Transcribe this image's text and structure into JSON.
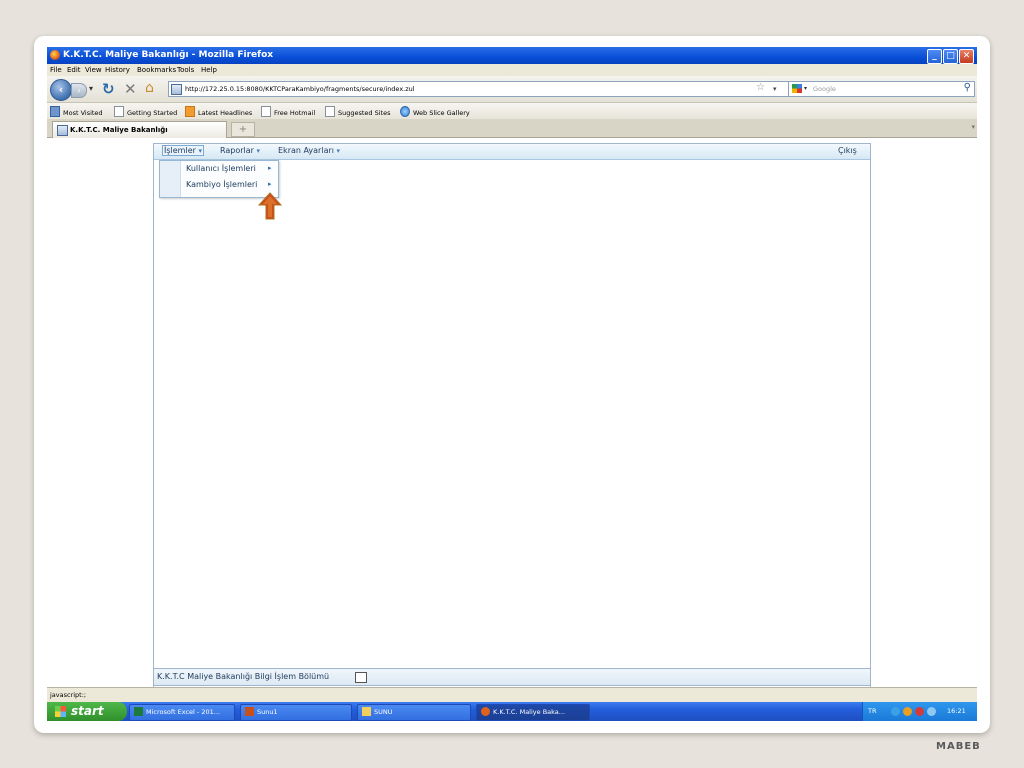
{
  "window": {
    "title": "K.K.T.C. Maliye Bakanlığı - Mozilla Firefox",
    "buttons": [
      "minimize",
      "maximize",
      "close"
    ]
  },
  "menubar": {
    "items": [
      "File",
      "Edit",
      "View",
      "History",
      "Bookmarks",
      "Tools",
      "Help"
    ]
  },
  "navbar": {
    "url": "http://172.25.0.15:8080/KKTCParaKambiyo/fragments/secure/index.zul",
    "search_placeholder": "Google"
  },
  "bookmarks": {
    "items": [
      "Most Visited",
      "Getting Started",
      "Latest Headlines",
      "Free Hotmail",
      "Suggested Sites",
      "Web Slice Gallery"
    ]
  },
  "tabs": {
    "active": "K.K.T.C. Maliye Bakanlığı",
    "new_tab": "+"
  },
  "app": {
    "menu": {
      "islemler": "İşlemler",
      "raporlar": "Raporlar",
      "ekran": "Ekran Ayarları",
      "cikis": "Çıkış",
      "caret": "▾"
    },
    "dropdown": {
      "items": [
        "Kullanıcı İşlemleri",
        "Kambiyo İşlemleri"
      ],
      "submenu_glyph": "▸"
    },
    "footer": "K.K.T.C Maliye Bakanlığı Bilgi İşlem Bölümü"
  },
  "statusbar": {
    "text": "javascript:;"
  },
  "taskbar": {
    "start": "start",
    "tasks": [
      "Microsoft Excel - 201...",
      "Sunu1",
      "SUNU",
      "K.K.T.C. Maliye Baka..."
    ],
    "language": "TR",
    "clock": "16:21"
  },
  "slide_footer": "MABEB",
  "colors": {
    "titlebar": "#0a4fd8",
    "app_border": "#9fb6cd",
    "arrow": "#d04a1c"
  }
}
